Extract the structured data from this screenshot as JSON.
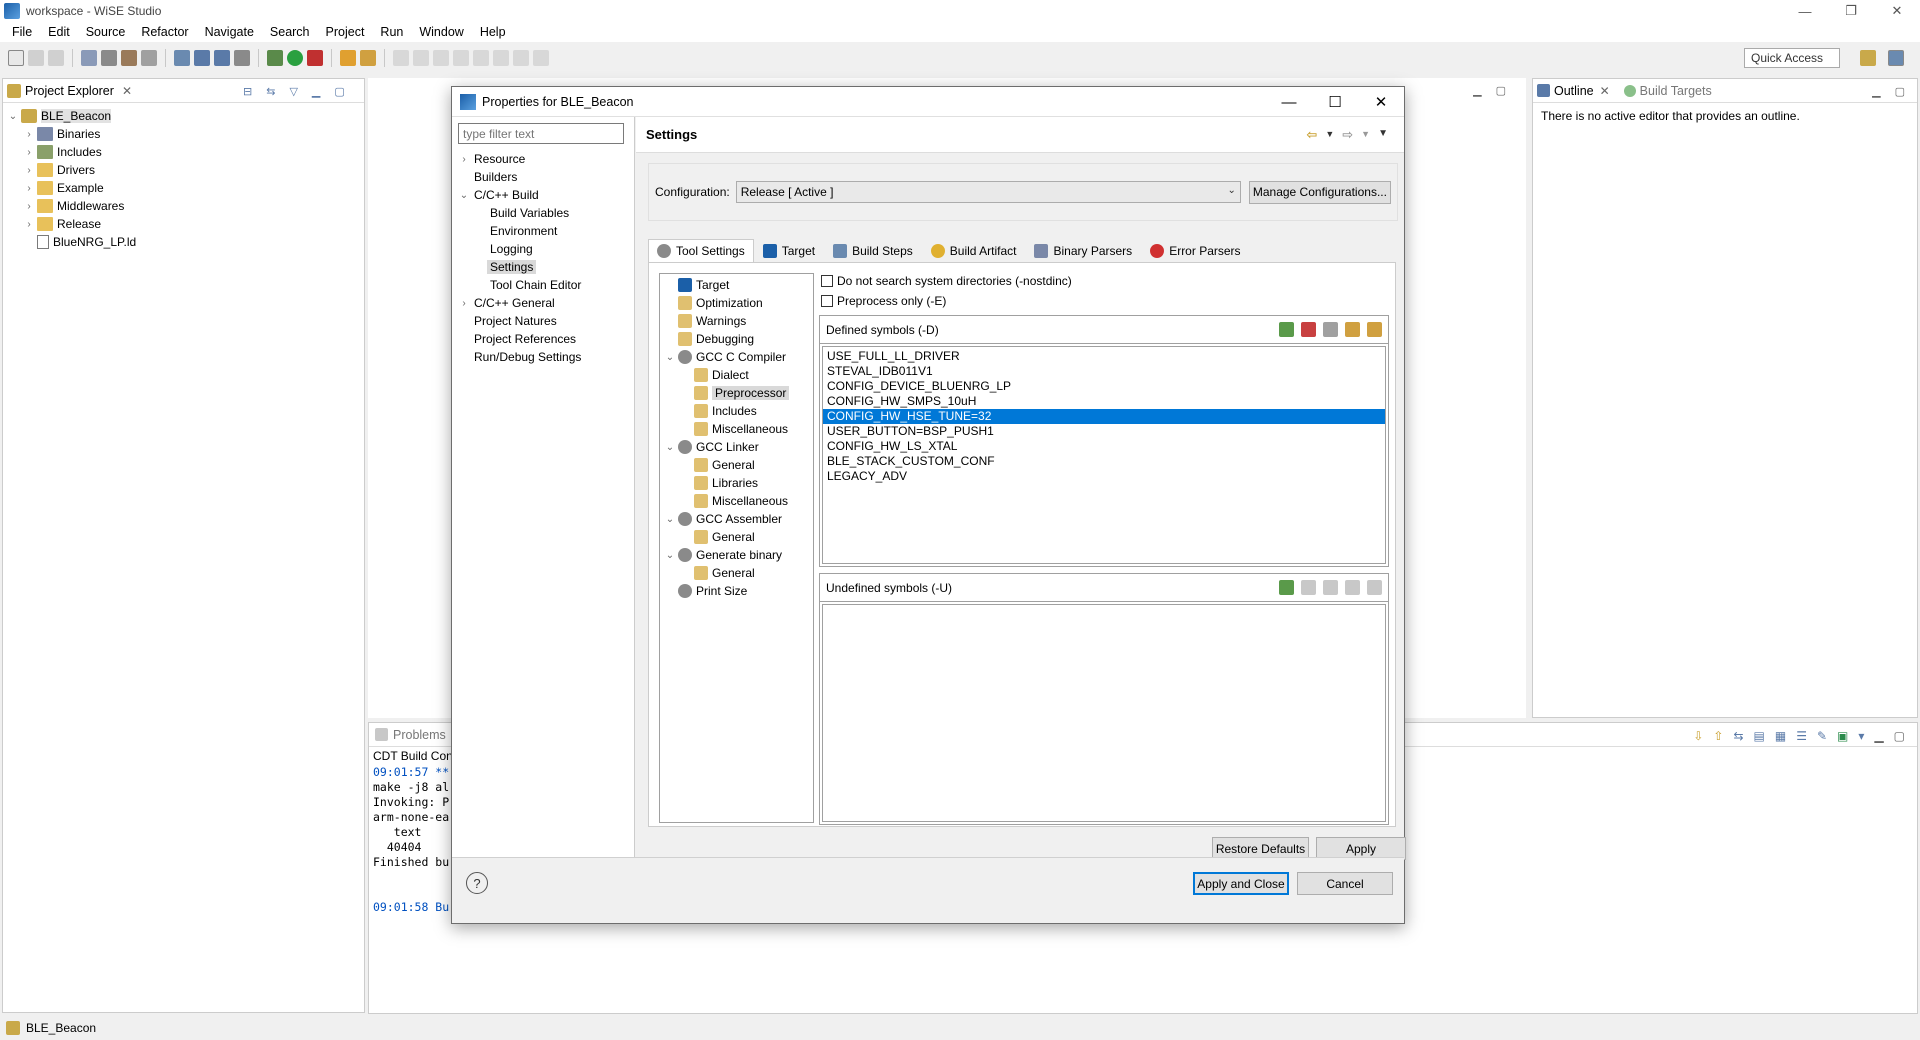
{
  "window": {
    "title": "workspace - WiSE Studio",
    "controls": [
      "—",
      "❐",
      "✕"
    ]
  },
  "menu": [
    "File",
    "Edit",
    "Source",
    "Refactor",
    "Navigate",
    "Search",
    "Project",
    "Run",
    "Window",
    "Help"
  ],
  "quick_access": "Quick Access",
  "project_explorer": {
    "tab_label": "Project Explorer",
    "tree": [
      {
        "label": "BLE_Beacon",
        "icon": "project-icon",
        "expanded": true,
        "level": 0
      },
      {
        "label": "Binaries",
        "icon": "binaries-icon",
        "level": 1
      },
      {
        "label": "Includes",
        "icon": "includes-icon",
        "level": 1
      },
      {
        "label": "Drivers",
        "icon": "folder-icon",
        "level": 1
      },
      {
        "label": "Example",
        "icon": "folder-icon",
        "level": 1
      },
      {
        "label": "Middlewares",
        "icon": "folder-icon",
        "level": 1
      },
      {
        "label": "Release",
        "icon": "folder-icon",
        "level": 1
      },
      {
        "label": "BlueNRG_LP.ld",
        "icon": "file-icon",
        "level": 1
      }
    ]
  },
  "outline": {
    "tab_label": "Outline",
    "tab2_label": "Build Targets",
    "message": "There is no active editor that provides an outline."
  },
  "console": {
    "tab_label": "Problems",
    "title": "CDT Build Cons",
    "lines": [
      {
        "text": "09:01:57 **",
        "color": "blue"
      },
      {
        "text": "make -j8 al",
        "color": "black"
      },
      {
        "text": "Invoking: P",
        "color": "black"
      },
      {
        "text": "arm-none-ea",
        "color": "black"
      },
      {
        "text": "   text",
        "color": "black"
      },
      {
        "text": "  40404",
        "color": "black"
      },
      {
        "text": "Finished bu",
        "color": "black"
      },
      {
        "text": "",
        "color": "black"
      },
      {
        "text": "",
        "color": "black"
      },
      {
        "text": "09:01:58 Bu",
        "color": "blue"
      }
    ]
  },
  "status": {
    "text": "BLE_Beacon"
  },
  "dialog": {
    "title": "Properties for BLE_Beacon",
    "filter_placeholder": "type filter text",
    "nav": [
      {
        "label": "Resource",
        "level": 0,
        "twisty": "›"
      },
      {
        "label": "Builders",
        "level": 0,
        "twisty": ""
      },
      {
        "label": "C/C++ Build",
        "level": 0,
        "twisty": "⌄"
      },
      {
        "label": "Build Variables",
        "level": 1,
        "twisty": ""
      },
      {
        "label": "Environment",
        "level": 1,
        "twisty": ""
      },
      {
        "label": "Logging",
        "level": 1,
        "twisty": ""
      },
      {
        "label": "Settings",
        "level": 1,
        "twisty": "",
        "selected": true
      },
      {
        "label": "Tool Chain Editor",
        "level": 1,
        "twisty": ""
      },
      {
        "label": "C/C++ General",
        "level": 0,
        "twisty": "›"
      },
      {
        "label": "Project Natures",
        "level": 0,
        "twisty": ""
      },
      {
        "label": "Project References",
        "level": 0,
        "twisty": ""
      },
      {
        "label": "Run/Debug Settings",
        "level": 0,
        "twisty": ""
      }
    ],
    "heading": "Settings",
    "configuration_label": "Configuration:",
    "configuration_value": "Release  [ Active ]",
    "manage_button": "Manage Configurations...",
    "tabs": [
      {
        "label": "Tool Settings",
        "icon": "tool-settings-icon",
        "color": "#8a8a8a",
        "active": true
      },
      {
        "label": "Target",
        "icon": "target-icon",
        "color": "#1b5fa8"
      },
      {
        "label": "Build Steps",
        "icon": "build-steps-icon",
        "color": "#6a8ab0"
      },
      {
        "label": "Build Artifact",
        "icon": "build-artifact-icon",
        "color": "#e0b030"
      },
      {
        "label": "Binary Parsers",
        "icon": "binary-parsers-icon",
        "color": "#7a88a8"
      },
      {
        "label": "Error Parsers",
        "icon": "error-parsers-icon",
        "color": "#d03030"
      }
    ],
    "tool_tree": [
      {
        "label": "Target",
        "level": 0,
        "twisty": "",
        "icon": "#1b5fa8"
      },
      {
        "label": "Optimization",
        "level": 0,
        "twisty": "",
        "icon": "#e0c070"
      },
      {
        "label": "Warnings",
        "level": 0,
        "twisty": "",
        "icon": "#e0c070"
      },
      {
        "label": "Debugging",
        "level": 0,
        "twisty": "",
        "icon": "#e0c070"
      },
      {
        "label": "GCC C Compiler",
        "level": 0,
        "twisty": "⌄",
        "icon": "#8a8a8a"
      },
      {
        "label": "Dialect",
        "level": 1,
        "twisty": "",
        "icon": "#e0c070"
      },
      {
        "label": "Preprocessor",
        "level": 1,
        "twisty": "",
        "icon": "#e0c070",
        "selected": true
      },
      {
        "label": "Includes",
        "level": 1,
        "twisty": "",
        "icon": "#e0c070"
      },
      {
        "label": "Miscellaneous",
        "level": 1,
        "twisty": "",
        "icon": "#e0c070"
      },
      {
        "label": "GCC Linker",
        "level": 0,
        "twisty": "⌄",
        "icon": "#8a8a8a"
      },
      {
        "label": "General",
        "level": 1,
        "twisty": "",
        "icon": "#e0c070"
      },
      {
        "label": "Libraries",
        "level": 1,
        "twisty": "",
        "icon": "#e0c070"
      },
      {
        "label": "Miscellaneous",
        "level": 1,
        "twisty": "",
        "icon": "#e0c070"
      },
      {
        "label": "GCC Assembler",
        "level": 0,
        "twisty": "⌄",
        "icon": "#8a8a8a"
      },
      {
        "label": "General",
        "level": 1,
        "twisty": "",
        "icon": "#e0c070"
      },
      {
        "label": "Generate binary",
        "level": 0,
        "twisty": "⌄",
        "icon": "#8a8a8a"
      },
      {
        "label": "General",
        "level": 1,
        "twisty": "",
        "icon": "#e0c070"
      },
      {
        "label": "Print Size",
        "level": 0,
        "twisty": "",
        "icon": "#8a8a8a"
      }
    ],
    "checkboxes": [
      {
        "label": "Do not search system directories (-nostdinc)",
        "checked": false
      },
      {
        "label": "Preprocess only (-E)",
        "checked": false
      }
    ],
    "defined_title": "Defined symbols (-D)",
    "defined_symbols": [
      "USE_FULL_LL_DRIVER",
      "STEVAL_IDB011V1",
      "CONFIG_DEVICE_BLUENRG_LP",
      "CONFIG_HW_SMPS_10uH",
      "CONFIG_HW_HSE_TUNE=32",
      "USER_BUTTON=BSP_PUSH1",
      "CONFIG_HW_LS_XTAL",
      "BLE_STACK_CUSTOM_CONF",
      "LEGACY_ADV"
    ],
    "selected_symbol_index": 4,
    "undefined_title": "Undefined symbols (-U)",
    "restore_defaults": "Restore Defaults",
    "apply": "Apply",
    "apply_close": "Apply and Close",
    "cancel": "Cancel",
    "help_glyph": "?"
  },
  "colors": {
    "selection": "#0078d7",
    "accent": "#1b5fa8",
    "console_blue": "#0050c0"
  }
}
